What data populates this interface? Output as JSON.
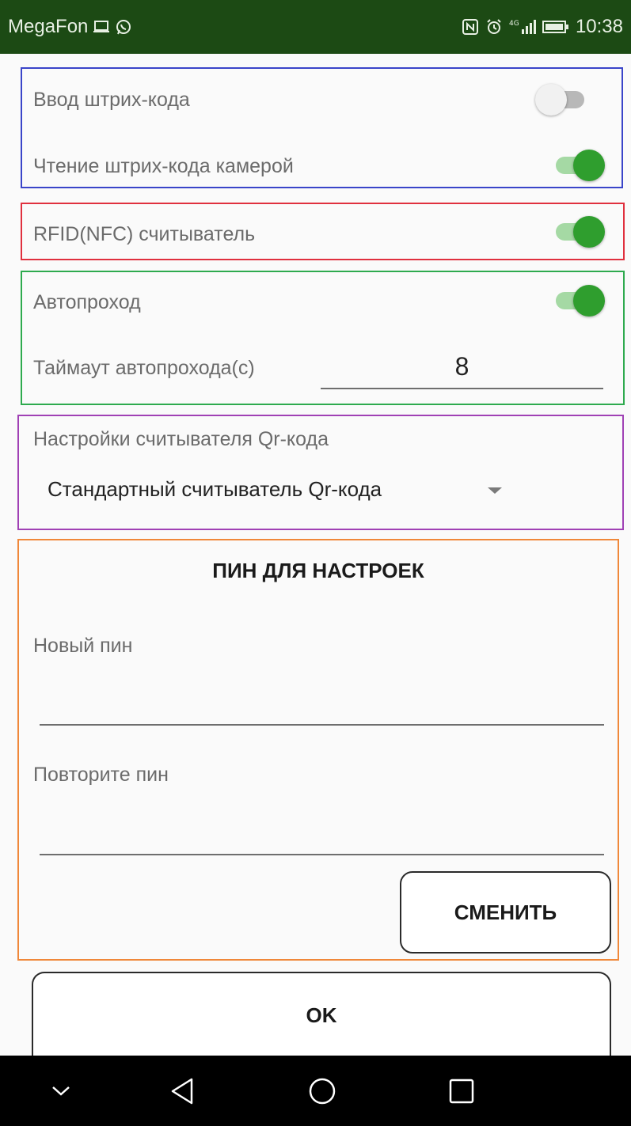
{
  "status_bar": {
    "carrier": "MegaFon",
    "network": "4G",
    "time": "10:38",
    "icons": [
      "laptop-icon",
      "whatsapp-icon",
      "nfc-icon",
      "alarm-icon",
      "signal-icon",
      "battery-icon"
    ]
  },
  "barcode_group": {
    "manual_input_label": "Ввод штрих-кода",
    "manual_input_enabled": false,
    "camera_label": "Чтение штрих-кода камерой",
    "camera_enabled": true
  },
  "rfid_group": {
    "rfid_label": "RFID(NFC) считыватель",
    "rfid_enabled": true
  },
  "autopass_group": {
    "autopass_label": "Автопроход",
    "autopass_enabled": true,
    "timeout_label": "Таймаут автопрохода(с)",
    "timeout_value": "8"
  },
  "qr_group": {
    "settings_label": "Настройки считывателя Qr-кода",
    "selected_reader": "Стандартный считыватель Qr-кода"
  },
  "pin_group": {
    "title": "ПИН ДЛЯ НАСТРОЕК",
    "new_pin_label": "Новый пин",
    "new_pin_value": "",
    "repeat_pin_label": "Повторите пин",
    "repeat_pin_value": "",
    "change_button": "СМЕНИТЬ"
  },
  "ok_button": "OK",
  "nav_bar": {
    "icons": [
      "chevron-down-icon",
      "back-icon",
      "home-icon",
      "recents-icon"
    ]
  },
  "colors": {
    "status_bar": "#1c4a14",
    "switch_on": "#2f9e2e",
    "switch_on_track": "#a5d9a4",
    "border_blue": "#3a45c9",
    "border_red": "#e0303e",
    "border_green": "#2eaa4e",
    "border_purple": "#a041b5",
    "border_orange": "#f0883a"
  }
}
